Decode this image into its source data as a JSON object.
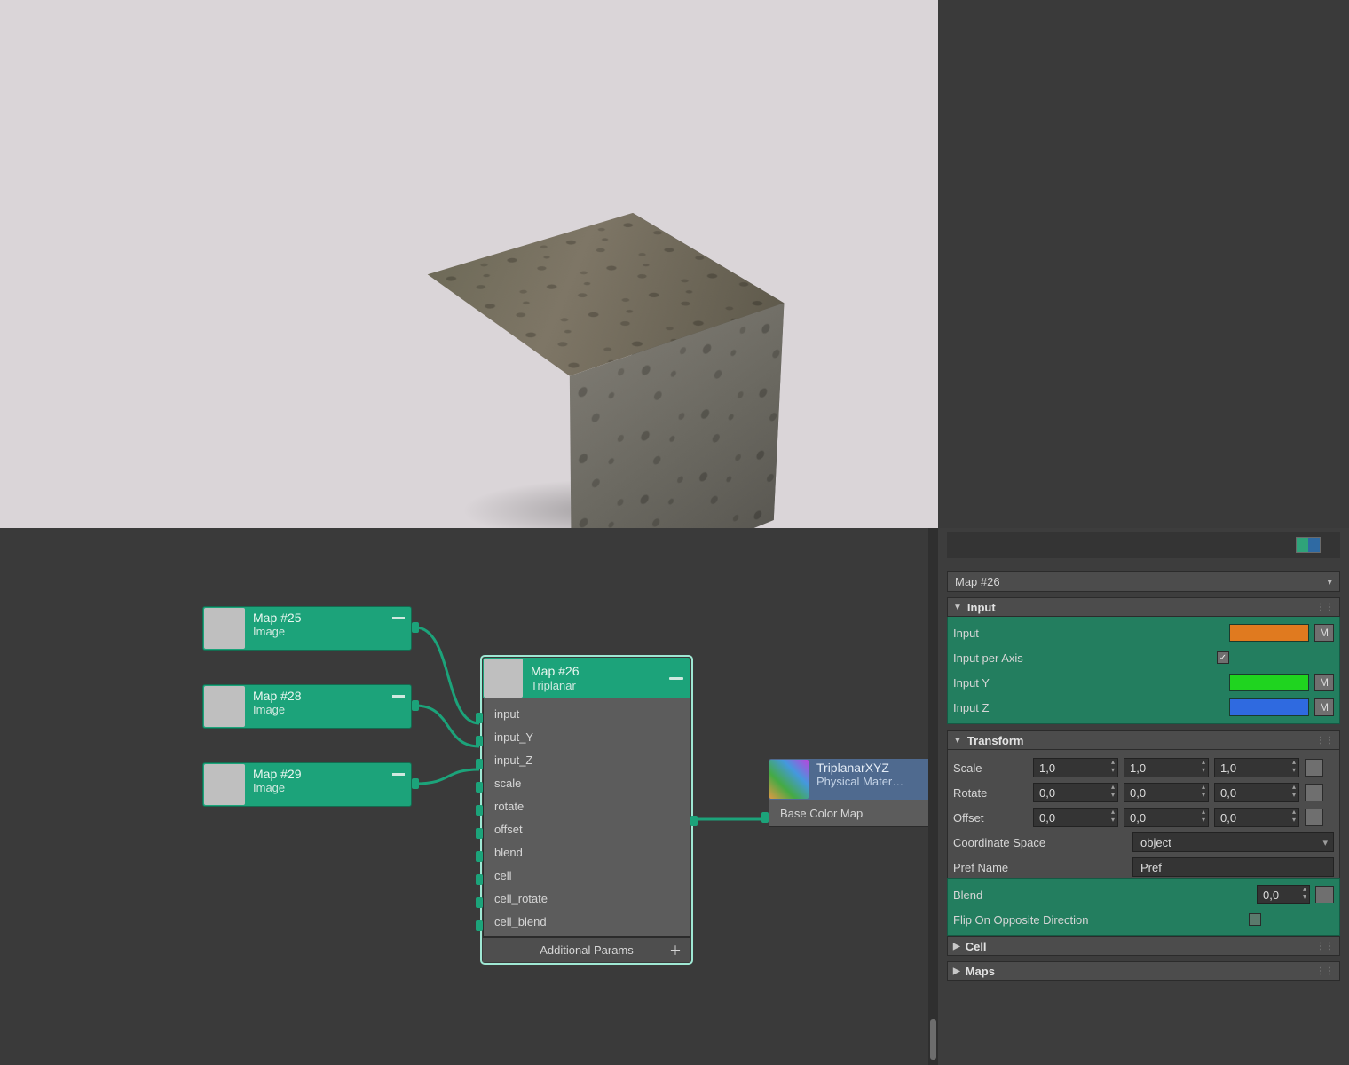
{
  "viewport": {
    "object": "Cube",
    "material": "Triplanar"
  },
  "nodes": {
    "small": [
      {
        "title": "Map #25",
        "sub": "Image"
      },
      {
        "title": "Map #28",
        "sub": "Image"
      },
      {
        "title": "Map #29",
        "sub": "Image"
      }
    ],
    "main": {
      "title": "Map #26",
      "sub": "Triplanar",
      "params": [
        "input",
        "input_Y",
        "input_Z",
        "scale",
        "rotate",
        "offset",
        "blend",
        "cell",
        "cell_rotate",
        "cell_blend"
      ],
      "footer": "Additional Params"
    },
    "material": {
      "title": "TriplanarXYZ",
      "sub": "Physical Mater…",
      "slot": "Base Color Map"
    }
  },
  "panel": {
    "title": "Map #26",
    "sections": {
      "input": {
        "header": "Input",
        "rows": {
          "input_label": "Input",
          "input_per_axis_label": "Input per Axis",
          "input_per_axis_checked": true,
          "input_y_label": "Input Y",
          "input_z_label": "Input Z",
          "m": "M",
          "swatch_input": "#e07a1f",
          "swatch_y": "#1fd41f",
          "swatch_z": "#2f6ae0"
        }
      },
      "transform": {
        "header": "Transform",
        "scale_label": "Scale",
        "scale": [
          "1,0",
          "1,0",
          "1,0"
        ],
        "rotate_label": "Rotate",
        "rotate": [
          "0,0",
          "0,0",
          "0,0"
        ],
        "offset_label": "Offset",
        "offset": [
          "0,0",
          "0,0",
          "0,0"
        ],
        "coord_label": "Coordinate Space",
        "coord_value": "object",
        "pref_label": "Pref Name",
        "pref_value": "Pref"
      },
      "blend": {
        "header_hidden": "",
        "blend_label": "Blend",
        "blend_value": "0,0",
        "flip_label": "Flip On Opposite Direction",
        "flip_checked": false
      },
      "cell": {
        "header": "Cell"
      },
      "maps": {
        "header": "Maps"
      }
    }
  }
}
